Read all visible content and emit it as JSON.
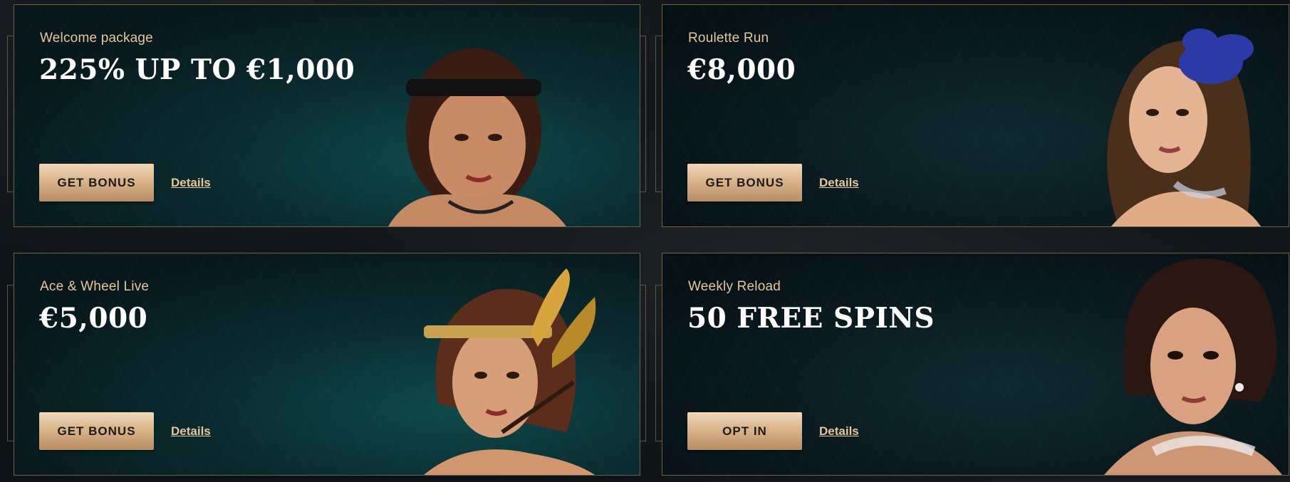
{
  "promos": [
    {
      "subtitle": "Welcome package",
      "headline": "225% UP TO €1,000",
      "button_label": "GET BONUS",
      "details_label": "Details"
    },
    {
      "subtitle": "Roulette Run",
      "headline": "€8,000",
      "button_label": "GET BONUS",
      "details_label": "Details"
    },
    {
      "subtitle": "Ace & Wheel Live",
      "headline": "€5,000",
      "button_label": "GET BONUS",
      "details_label": "Details"
    },
    {
      "subtitle": "Weekly Reload",
      "headline": "50 FREE SPINS",
      "button_label": "OPT IN",
      "details_label": "Details"
    }
  ],
  "colors": {
    "accent_gold": "#e6c59a",
    "button_gradient_top": "#f1d8b9",
    "button_gradient_bottom": "#b88d64",
    "card_border": "#6f6242",
    "card_teal": "#0f4a4a"
  }
}
